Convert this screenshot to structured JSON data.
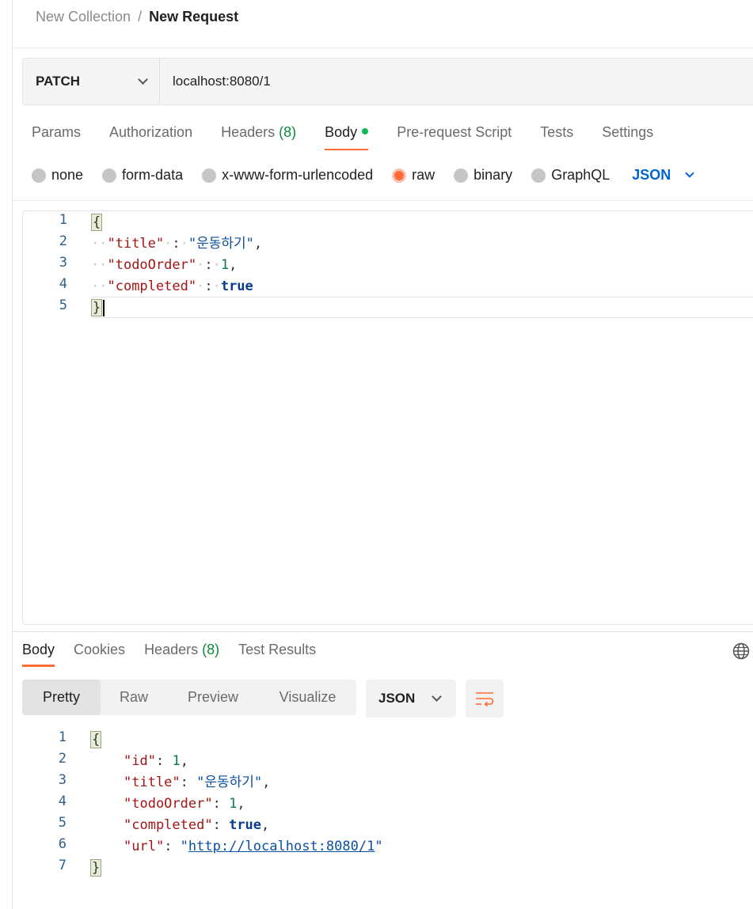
{
  "breadcrumb": {
    "parent": "New Collection",
    "separator": "/",
    "current": "New Request"
  },
  "request": {
    "method": "PATCH",
    "url": "localhost:8080/1"
  },
  "request_tabs": [
    {
      "label": "Params"
    },
    {
      "label": "Authorization"
    },
    {
      "label": "Headers",
      "count": "(8)"
    },
    {
      "label": "Body"
    },
    {
      "label": "Pre-request Script"
    },
    {
      "label": "Tests"
    },
    {
      "label": "Settings"
    }
  ],
  "body_types": [
    {
      "label": "none",
      "selected": false
    },
    {
      "label": "form-data",
      "selected": false
    },
    {
      "label": "x-www-form-urlencoded",
      "selected": false
    },
    {
      "label": "raw",
      "selected": true
    },
    {
      "label": "binary",
      "selected": false
    },
    {
      "label": "GraphQL",
      "selected": false
    }
  ],
  "body_language": "JSON",
  "request_body": {
    "line_numbers": [
      "1",
      "2",
      "3",
      "4",
      "5"
    ],
    "open_brace": "{",
    "close_brace": "}",
    "key_title": "\"title\"",
    "val_title": "\"운동하기\"",
    "key_order": "\"todoOrder\"",
    "val_order": "1",
    "key_completed": "\"completed\"",
    "val_completed": "true"
  },
  "response_tabs": [
    {
      "label": "Body"
    },
    {
      "label": "Cookies"
    },
    {
      "label": "Headers",
      "count": "(8)"
    },
    {
      "label": "Test Results"
    }
  ],
  "view_modes": [
    "Pretty",
    "Raw",
    "Preview",
    "Visualize"
  ],
  "response_format": "JSON",
  "response_body": {
    "line_numbers": [
      "1",
      "2",
      "3",
      "4",
      "5",
      "6",
      "7"
    ],
    "open_brace": "{",
    "close_brace": "}",
    "key_id": "\"id\"",
    "val_id": "1",
    "key_title": "\"title\"",
    "val_title": "\"운동하기\"",
    "key_order": "\"todoOrder\"",
    "val_order": "1",
    "key_completed": "\"completed\"",
    "val_completed": "true",
    "key_url": "\"url\"",
    "val_url": "http://localhost:8080/1"
  },
  "colors": {
    "accent": "#ff6c37",
    "link": "#0265d2",
    "success": "#0cbb52"
  },
  "icons": [
    "chevron-down-icon",
    "globe-icon",
    "wrap-lines-icon"
  ]
}
